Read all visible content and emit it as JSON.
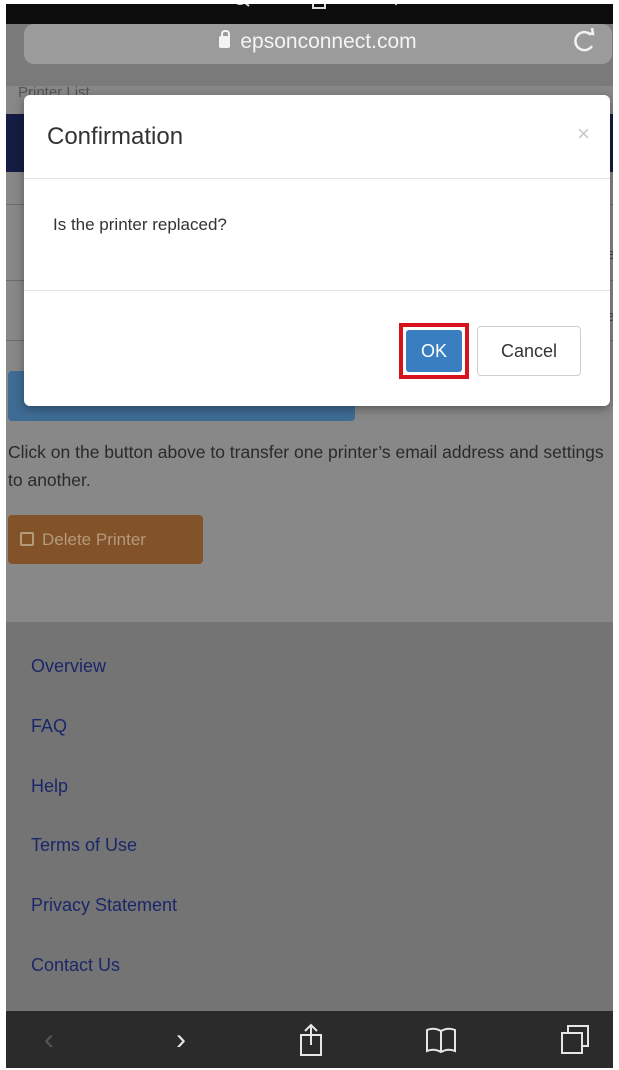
{
  "browser": {
    "url": "epsonconnect.com",
    "icons": [
      "search-icon",
      "share-icon",
      "bookmark-icon",
      "lock-icon",
      "reload-icon"
    ]
  },
  "page": {
    "breadcrumb": "Printer List",
    "row_ghost_1": "e",
    "row_ghost_2": "e",
    "replace_description": "Click on the button above to transfer one printer’s email address and settings to another.",
    "delete_printer_label": "Delete Printer"
  },
  "modal": {
    "title": "Confirmation",
    "close_symbol": "×",
    "message": "Is the printer replaced?",
    "ok_label": "OK",
    "cancel_label": "Cancel",
    "highlight_color": "#d8121d"
  },
  "footer": {
    "links": [
      "Overview",
      "FAQ",
      "Help",
      "Terms of Use",
      "Privacy Statement",
      "Contact Us"
    ]
  },
  "toolbar": {
    "back_symbol": "‹",
    "forward_symbol": "›",
    "icons": [
      "back-icon",
      "forward-icon",
      "share-icon",
      "bookmarks-icon",
      "tabs-icon"
    ]
  },
  "colors": {
    "ok_button": "#3a7ec2",
    "delete_button": "#825228",
    "header_bar": "#141c43",
    "footer_link": "#1b2768"
  }
}
